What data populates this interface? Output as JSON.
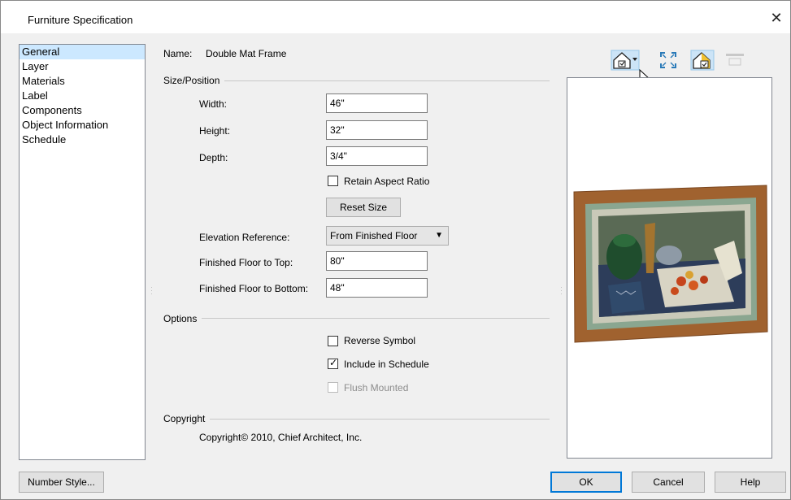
{
  "window": {
    "title": "Furniture Specification"
  },
  "nav": {
    "items": [
      {
        "label": "General",
        "selected": true
      },
      {
        "label": "Layer"
      },
      {
        "label": "Materials"
      },
      {
        "label": "Label"
      },
      {
        "label": "Components"
      },
      {
        "label": "Object Information"
      },
      {
        "label": "Schedule"
      }
    ]
  },
  "general": {
    "name_label": "Name:",
    "name_value": "Double Mat Frame",
    "size_group": "Size/Position",
    "width_label": "Width:",
    "width_value": "46\"",
    "height_label": "Height:",
    "height_value": "32\"",
    "depth_label": "Depth:",
    "depth_value": "3/4\"",
    "retain_aspect_label": "Retain Aspect Ratio",
    "retain_aspect_checked": false,
    "reset_size_label": "Reset Size",
    "elev_ref_label": "Elevation Reference:",
    "elev_ref_value": "From Finished Floor",
    "ff_top_label": "Finished Floor to Top:",
    "ff_top_value": "80\"",
    "ff_bottom_label": "Finished Floor to Bottom:",
    "ff_bottom_value": "48\"",
    "options_group": "Options",
    "reverse_symbol_label": "Reverse Symbol",
    "reverse_symbol_checked": false,
    "include_schedule_label": "Include in Schedule",
    "include_schedule_checked": true,
    "flush_mounted_label": "Flush Mounted",
    "flush_mounted_disabled": true,
    "copyright_group": "Copyright",
    "copyright_text": "Copyright© 2010, Chief Architect, Inc."
  },
  "footer": {
    "number_style_label": "Number Style...",
    "ok_label": "OK",
    "cancel_label": "Cancel",
    "help_label": "Help"
  },
  "preview_toolbar": {
    "icons": [
      "camera-view-icon",
      "fill-window-icon",
      "preview-mode-icon",
      "disabled-toolbar-icon"
    ]
  },
  "colors": {
    "selection": "#cce8ff",
    "accent": "#0078d7",
    "frame_wood": "#a0622f",
    "mat_green": "#8aa690"
  }
}
